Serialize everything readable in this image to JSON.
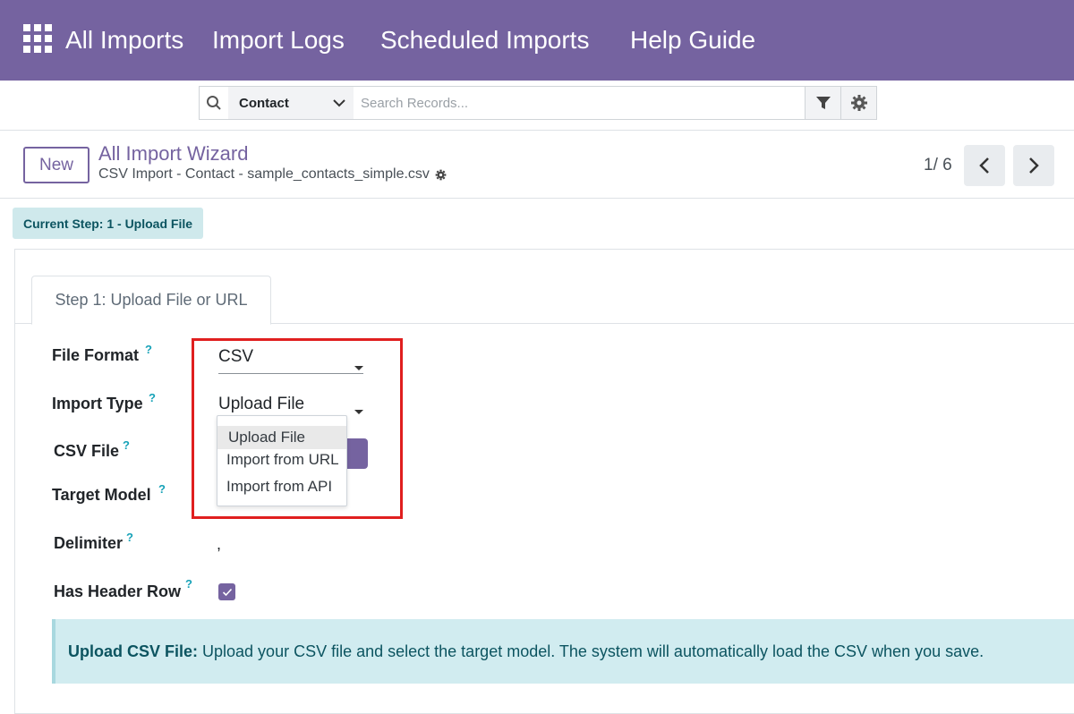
{
  "navbar": {
    "apps_icon": "grid-icon",
    "items": [
      "All Imports",
      "Import Logs",
      "Scheduled Imports",
      "Help Guide"
    ]
  },
  "search": {
    "model": "Contact",
    "placeholder": "Search Records..."
  },
  "control": {
    "new_label": "New",
    "title": "All Import Wizard",
    "subtitle": "CSV Import - Contact - sample_contacts_simple.csv",
    "pager": "1/ 6"
  },
  "step_badge": "Current Step: 1 - Upload File",
  "tab_label": "Step 1: Upload File or URL",
  "form": {
    "file_format_label": "File Format",
    "file_format_value": "CSV",
    "import_type_label": "Import Type",
    "import_type_value": "Upload File",
    "csv_file_label": "CSV File",
    "target_model_label": "Target Model",
    "delimiter_label": "Delimiter",
    "delimiter_value": ",",
    "header_row_label": "Has Header Row",
    "header_row_checked": true,
    "help_mark": "?"
  },
  "dropdown": {
    "options": [
      "Upload File",
      "Import from URL",
      "Import from API"
    ],
    "selected": "Upload File"
  },
  "alert": {
    "title": "Upload CSV File:",
    "text": "Upload your CSV file and select the target model. The system will automatically load the CSV when you save."
  },
  "colors": {
    "brand": "#7563a0",
    "highlight": "#e01f1f",
    "info_bg": "#d1ecf0",
    "info_text": "#0c5460"
  }
}
